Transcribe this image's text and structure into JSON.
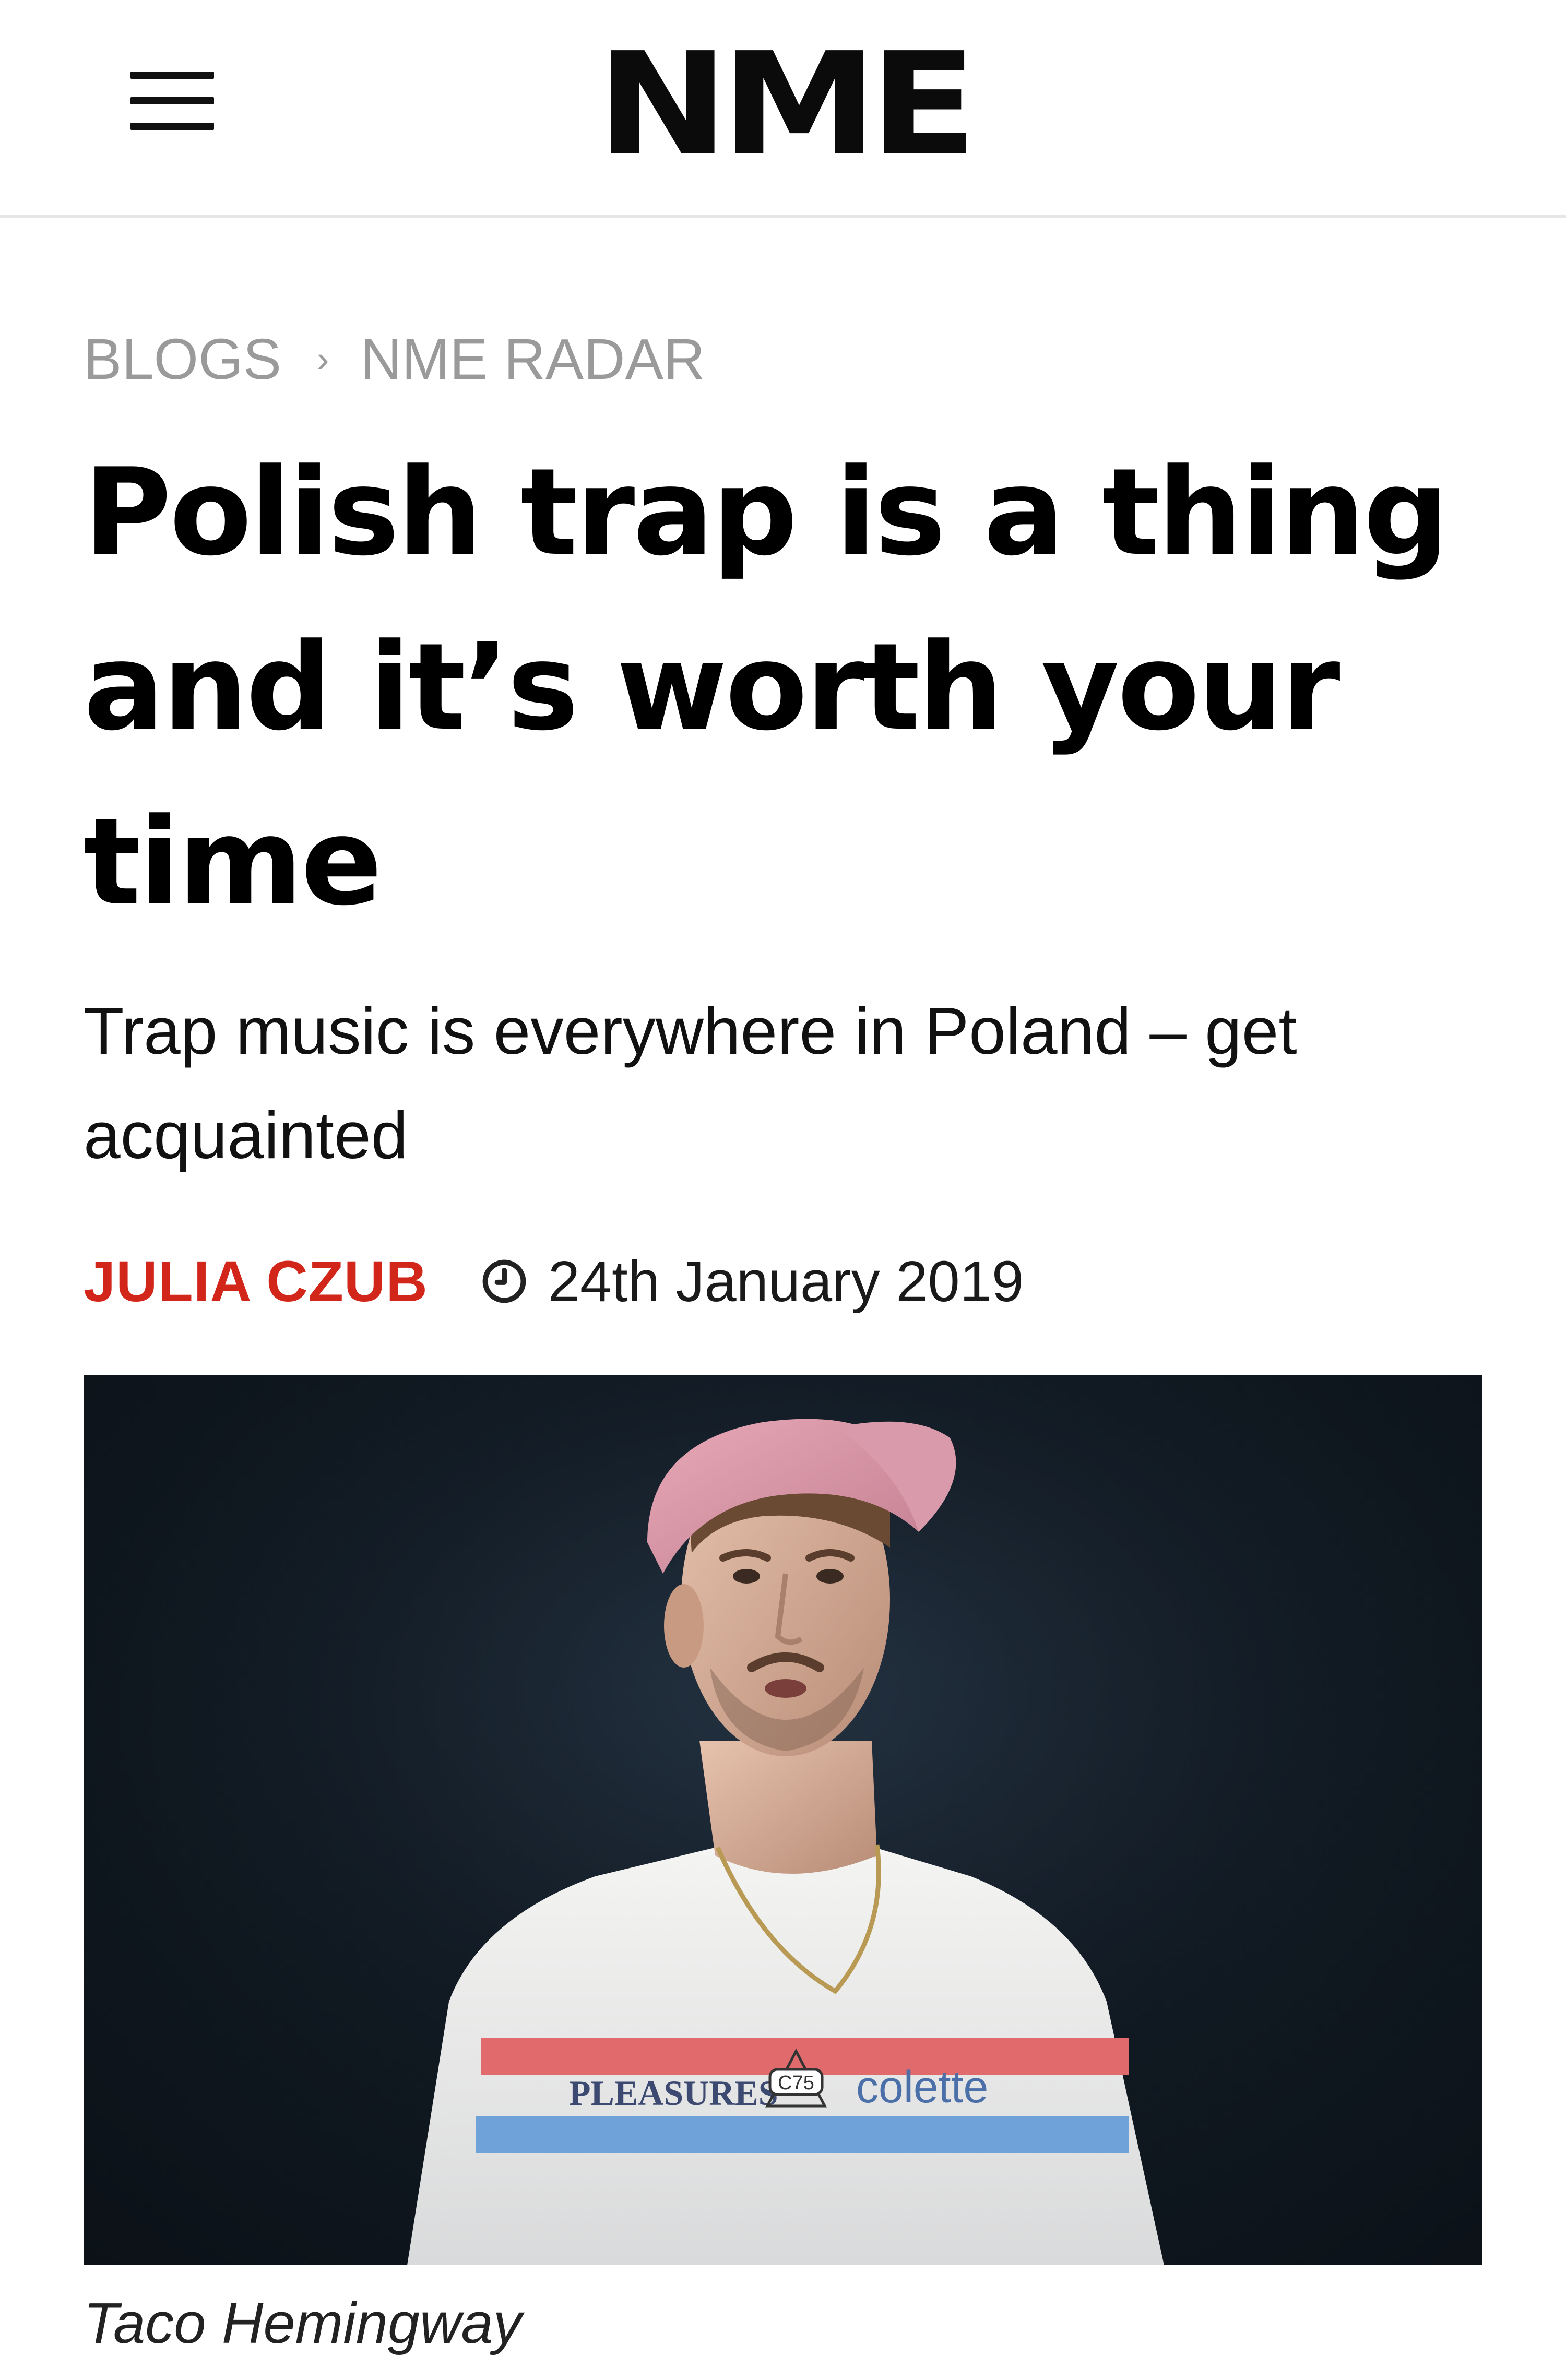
{
  "header": {
    "logo": "NME",
    "menu_icon": "hamburger-menu-icon"
  },
  "breadcrumb": {
    "items": [
      "BLOGS",
      "NME RADAR"
    ],
    "separator": "›"
  },
  "article": {
    "title": "Polish trap is a thing and it’s worth your time",
    "subtitle": "Trap music is everywhere in Poland – get acquainted",
    "author": "JULIA CZUB",
    "date": "24th January 2019",
    "date_icon": "clock-icon",
    "image": {
      "shirt_text_left": "PLEASURES",
      "shirt_badge": "C75",
      "shirt_text_right": "colette"
    },
    "caption": "Taco Hemingway"
  },
  "colors": {
    "author": "#d2261b",
    "breadcrumb": "#9a9a9a",
    "divider": "#e6e6e6"
  }
}
